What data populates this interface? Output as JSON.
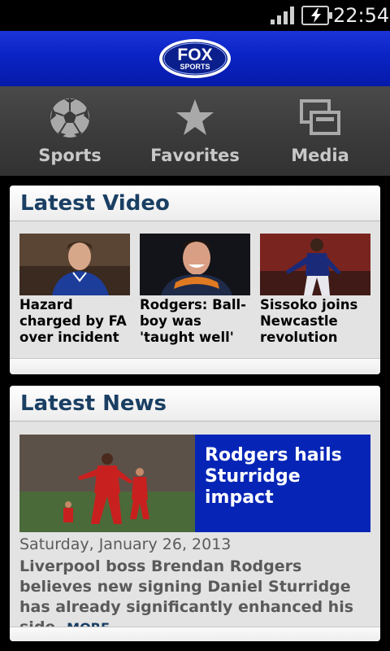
{
  "status_bar": {
    "time": "22:54",
    "icons": [
      "signal-icon",
      "battery-charging-icon"
    ]
  },
  "header": {
    "logo": {
      "line1": "FOX",
      "line2": "SPORTS",
      "icon": "fox-sports-logo"
    }
  },
  "nav": [
    {
      "label": "Sports",
      "icon": "soccer-ball-icon"
    },
    {
      "label": "Favorites",
      "icon": "star-icon"
    },
    {
      "label": "Media",
      "icon": "media-windows-icon"
    }
  ],
  "latest_video": {
    "title": "Latest Video",
    "items": [
      {
        "caption": "Hazard charged by FA over incident"
      },
      {
        "caption": "Rodgers: Ball-boy was 'taught well'"
      },
      {
        "caption": "Sissoko joins Newcastle revolution"
      }
    ]
  },
  "latest_news": {
    "title": "Latest News",
    "headline": "Rodgers hails Sturridge impact",
    "date": "Saturday, January 26, 2013",
    "summary": "Liverpool boss Brendan Rodgers believes new signing Daniel Sturridge has already significantly enhanced his side.",
    "more_label": "MORE"
  },
  "colors": {
    "header_blue": "#0a23c4",
    "title_navy": "#1a3f63",
    "headline_box": "#0625b6"
  }
}
